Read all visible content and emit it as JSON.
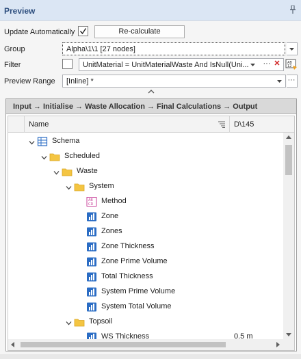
{
  "panel": {
    "title": "Preview"
  },
  "controls": {
    "update_auto_label": "Update Automatically",
    "update_auto_checked": true,
    "recalc_label": "Re-calculate",
    "group_label": "Group",
    "group_value": "Alpha\\1\\1 [27 nodes]",
    "filter_label": "Filter",
    "filter_checked": false,
    "filter_value": "UnitMaterial = UnitMaterialWaste And IsNull(Uni...",
    "filter_more": "···",
    "filter_clear": "✕",
    "range_label": "Preview Range",
    "range_value": "[Inline] *",
    "range_more": "···"
  },
  "pipeline": {
    "text": "Input → Initialise → Waste Allocation → Final Calculations → Output"
  },
  "grid": {
    "col_name": "Name",
    "col_value": "D\\145",
    "rows": [
      {
        "label": "Schema",
        "value": "",
        "icon": "table-icon"
      },
      {
        "label": "Scheduled",
        "value": "",
        "icon": "folder-icon"
      },
      {
        "label": "Waste",
        "value": "",
        "icon": "folder-icon"
      },
      {
        "label": "System",
        "value": "",
        "icon": "folder-icon"
      },
      {
        "label": "Method",
        "value": "",
        "icon": "text-field-icon"
      },
      {
        "label": "Zone",
        "value": "",
        "icon": "numeric-field-icon"
      },
      {
        "label": "Zones",
        "value": "",
        "icon": "numeric-field-icon"
      },
      {
        "label": "Zone Thickness",
        "value": "",
        "icon": "numeric-field-icon"
      },
      {
        "label": "Zone Prime Volume",
        "value": "",
        "icon": "numeric-field-icon"
      },
      {
        "label": "Total Thickness",
        "value": "",
        "icon": "numeric-field-icon"
      },
      {
        "label": "System Prime Volume",
        "value": "",
        "icon": "numeric-field-icon"
      },
      {
        "label": "System Total Volume",
        "value": "",
        "icon": "numeric-field-icon"
      },
      {
        "label": "Topsoil",
        "value": "",
        "icon": "folder-icon"
      },
      {
        "label": "WS Thickness",
        "value": "0.5 m",
        "icon": "numeric-field-icon"
      }
    ]
  },
  "colors": {
    "accent": "#2d4e7e",
    "folder": "#f4c542",
    "numeric_icon": "#2a6cc4",
    "text_icon": "#c8409a"
  }
}
